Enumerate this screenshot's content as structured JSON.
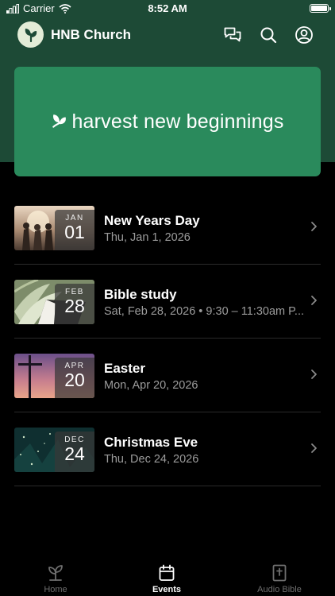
{
  "status_bar": {
    "carrier": "Carrier",
    "time": "8:52 AM"
  },
  "header": {
    "title": "HNB Church",
    "icons": [
      "chat-icon",
      "search-icon",
      "profile-icon"
    ]
  },
  "banner": {
    "text": "harvest new beginnings"
  },
  "events": [
    {
      "month": "JAN",
      "day": "01",
      "title": "New Years Day",
      "subtitle": "Thu, Jan 1, 2026"
    },
    {
      "month": "FEB",
      "day": "28",
      "title": "Bible study",
      "subtitle": "Sat, Feb 28, 2026 • 9:30 – 11:30am P..."
    },
    {
      "month": "APR",
      "day": "20",
      "title": "Easter",
      "subtitle": "Mon, Apr 20, 2026"
    },
    {
      "month": "DEC",
      "day": "24",
      "title": "Christmas Eve",
      "subtitle": "Thu, Dec 24, 2026"
    }
  ],
  "tabs": [
    {
      "label": "Home",
      "icon": "sprout-icon",
      "active": false
    },
    {
      "label": "Events",
      "icon": "calendar-icon",
      "active": true
    },
    {
      "label": "Audio Bible",
      "icon": "bible-icon",
      "active": false
    }
  ],
  "colors": {
    "header_bg": "#1d4a36",
    "banner_bg": "#2a8a5c",
    "background": "#000000",
    "subtitle": "#9c9c9c"
  }
}
